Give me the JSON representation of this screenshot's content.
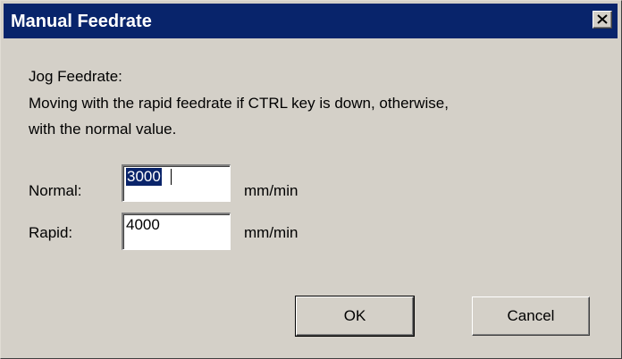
{
  "window": {
    "title": "Manual Feedrate"
  },
  "content": {
    "heading": "Jog Feedrate:",
    "description_line1": "Moving with the rapid feedrate if CTRL key is down, otherwise,",
    "description_line2": "with the normal value."
  },
  "fields": {
    "normal": {
      "label": "Normal:",
      "value": "3000",
      "unit": "mm/min",
      "selected": true
    },
    "rapid": {
      "label": "Rapid:",
      "value": "4000",
      "unit": "mm/min",
      "selected": false
    }
  },
  "buttons": {
    "ok_label": "OK",
    "cancel_label": "Cancel"
  },
  "colors": {
    "titlebar": "#08246b",
    "background": "#d4d0c8",
    "selection": "#0a246a"
  },
  "icons": {
    "close": "close-icon"
  }
}
